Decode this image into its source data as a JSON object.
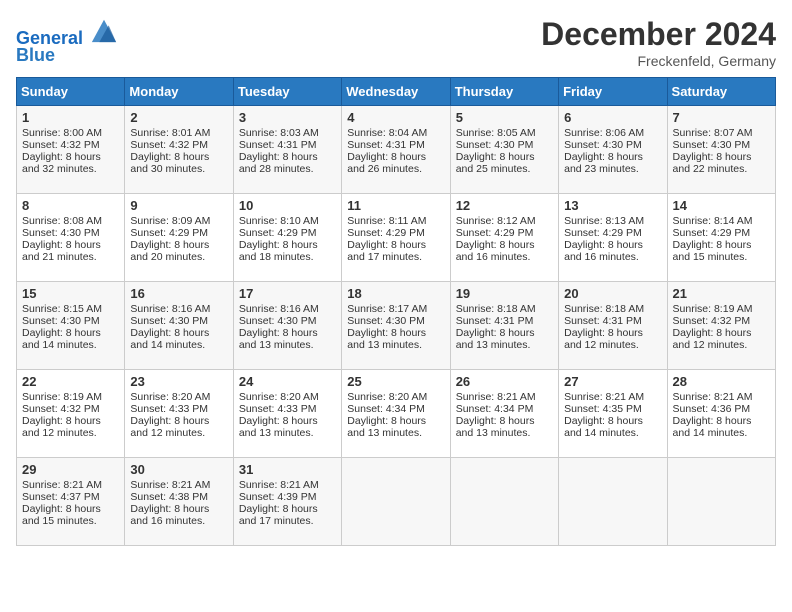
{
  "header": {
    "logo_line1": "General",
    "logo_line2": "Blue",
    "month": "December 2024",
    "location": "Freckenfeld, Germany"
  },
  "weekdays": [
    "Sunday",
    "Monday",
    "Tuesday",
    "Wednesday",
    "Thursday",
    "Friday",
    "Saturday"
  ],
  "weeks": [
    [
      {
        "day": "1",
        "sunrise": "Sunrise: 8:00 AM",
        "sunset": "Sunset: 4:32 PM",
        "daylight": "Daylight: 8 hours and 32 minutes."
      },
      {
        "day": "2",
        "sunrise": "Sunrise: 8:01 AM",
        "sunset": "Sunset: 4:32 PM",
        "daylight": "Daylight: 8 hours and 30 minutes."
      },
      {
        "day": "3",
        "sunrise": "Sunrise: 8:03 AM",
        "sunset": "Sunset: 4:31 PM",
        "daylight": "Daylight: 8 hours and 28 minutes."
      },
      {
        "day": "4",
        "sunrise": "Sunrise: 8:04 AM",
        "sunset": "Sunset: 4:31 PM",
        "daylight": "Daylight: 8 hours and 26 minutes."
      },
      {
        "day": "5",
        "sunrise": "Sunrise: 8:05 AM",
        "sunset": "Sunset: 4:30 PM",
        "daylight": "Daylight: 8 hours and 25 minutes."
      },
      {
        "day": "6",
        "sunrise": "Sunrise: 8:06 AM",
        "sunset": "Sunset: 4:30 PM",
        "daylight": "Daylight: 8 hours and 23 minutes."
      },
      {
        "day": "7",
        "sunrise": "Sunrise: 8:07 AM",
        "sunset": "Sunset: 4:30 PM",
        "daylight": "Daylight: 8 hours and 22 minutes."
      }
    ],
    [
      {
        "day": "8",
        "sunrise": "Sunrise: 8:08 AM",
        "sunset": "Sunset: 4:30 PM",
        "daylight": "Daylight: 8 hours and 21 minutes."
      },
      {
        "day": "9",
        "sunrise": "Sunrise: 8:09 AM",
        "sunset": "Sunset: 4:29 PM",
        "daylight": "Daylight: 8 hours and 20 minutes."
      },
      {
        "day": "10",
        "sunrise": "Sunrise: 8:10 AM",
        "sunset": "Sunset: 4:29 PM",
        "daylight": "Daylight: 8 hours and 18 minutes."
      },
      {
        "day": "11",
        "sunrise": "Sunrise: 8:11 AM",
        "sunset": "Sunset: 4:29 PM",
        "daylight": "Daylight: 8 hours and 17 minutes."
      },
      {
        "day": "12",
        "sunrise": "Sunrise: 8:12 AM",
        "sunset": "Sunset: 4:29 PM",
        "daylight": "Daylight: 8 hours and 16 minutes."
      },
      {
        "day": "13",
        "sunrise": "Sunrise: 8:13 AM",
        "sunset": "Sunset: 4:29 PM",
        "daylight": "Daylight: 8 hours and 16 minutes."
      },
      {
        "day": "14",
        "sunrise": "Sunrise: 8:14 AM",
        "sunset": "Sunset: 4:29 PM",
        "daylight": "Daylight: 8 hours and 15 minutes."
      }
    ],
    [
      {
        "day": "15",
        "sunrise": "Sunrise: 8:15 AM",
        "sunset": "Sunset: 4:30 PM",
        "daylight": "Daylight: 8 hours and 14 minutes."
      },
      {
        "day": "16",
        "sunrise": "Sunrise: 8:16 AM",
        "sunset": "Sunset: 4:30 PM",
        "daylight": "Daylight: 8 hours and 14 minutes."
      },
      {
        "day": "17",
        "sunrise": "Sunrise: 8:16 AM",
        "sunset": "Sunset: 4:30 PM",
        "daylight": "Daylight: 8 hours and 13 minutes."
      },
      {
        "day": "18",
        "sunrise": "Sunrise: 8:17 AM",
        "sunset": "Sunset: 4:30 PM",
        "daylight": "Daylight: 8 hours and 13 minutes."
      },
      {
        "day": "19",
        "sunrise": "Sunrise: 8:18 AM",
        "sunset": "Sunset: 4:31 PM",
        "daylight": "Daylight: 8 hours and 13 minutes."
      },
      {
        "day": "20",
        "sunrise": "Sunrise: 8:18 AM",
        "sunset": "Sunset: 4:31 PM",
        "daylight": "Daylight: 8 hours and 12 minutes."
      },
      {
        "day": "21",
        "sunrise": "Sunrise: 8:19 AM",
        "sunset": "Sunset: 4:32 PM",
        "daylight": "Daylight: 8 hours and 12 minutes."
      }
    ],
    [
      {
        "day": "22",
        "sunrise": "Sunrise: 8:19 AM",
        "sunset": "Sunset: 4:32 PM",
        "daylight": "Daylight: 8 hours and 12 minutes."
      },
      {
        "day": "23",
        "sunrise": "Sunrise: 8:20 AM",
        "sunset": "Sunset: 4:33 PM",
        "daylight": "Daylight: 8 hours and 12 minutes."
      },
      {
        "day": "24",
        "sunrise": "Sunrise: 8:20 AM",
        "sunset": "Sunset: 4:33 PM",
        "daylight": "Daylight: 8 hours and 13 minutes."
      },
      {
        "day": "25",
        "sunrise": "Sunrise: 8:20 AM",
        "sunset": "Sunset: 4:34 PM",
        "daylight": "Daylight: 8 hours and 13 minutes."
      },
      {
        "day": "26",
        "sunrise": "Sunrise: 8:21 AM",
        "sunset": "Sunset: 4:34 PM",
        "daylight": "Daylight: 8 hours and 13 minutes."
      },
      {
        "day": "27",
        "sunrise": "Sunrise: 8:21 AM",
        "sunset": "Sunset: 4:35 PM",
        "daylight": "Daylight: 8 hours and 14 minutes."
      },
      {
        "day": "28",
        "sunrise": "Sunrise: 8:21 AM",
        "sunset": "Sunset: 4:36 PM",
        "daylight": "Daylight: 8 hours and 14 minutes."
      }
    ],
    [
      {
        "day": "29",
        "sunrise": "Sunrise: 8:21 AM",
        "sunset": "Sunset: 4:37 PM",
        "daylight": "Daylight: 8 hours and 15 minutes."
      },
      {
        "day": "30",
        "sunrise": "Sunrise: 8:21 AM",
        "sunset": "Sunset: 4:38 PM",
        "daylight": "Daylight: 8 hours and 16 minutes."
      },
      {
        "day": "31",
        "sunrise": "Sunrise: 8:21 AM",
        "sunset": "Sunset: 4:39 PM",
        "daylight": "Daylight: 8 hours and 17 minutes."
      },
      null,
      null,
      null,
      null
    ]
  ]
}
